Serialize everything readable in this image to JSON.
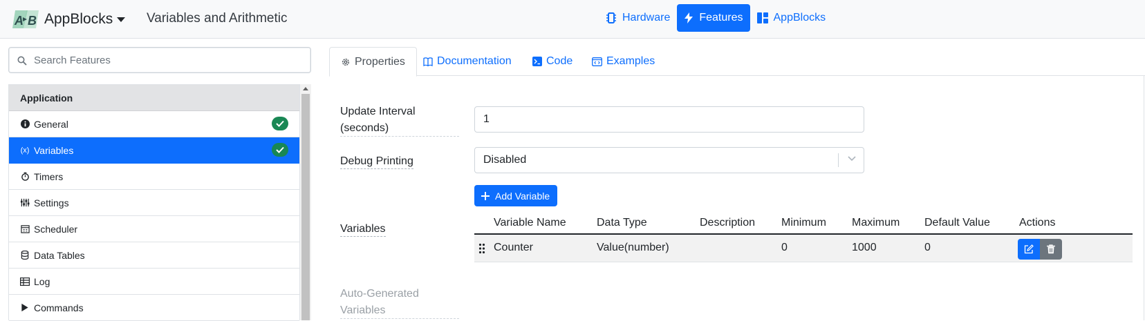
{
  "app": {
    "brand": "AppBlocks",
    "page_title": "Variables and Arithmetic",
    "accent_color": "#0d6efd",
    "success_color": "#198754"
  },
  "topnav": {
    "hardware": "Hardware",
    "features": "Features",
    "appblocks": "AppBlocks"
  },
  "sidebar": {
    "search_placeholder": "Search Features",
    "group": "Application",
    "items": [
      {
        "label": "General",
        "icon": "info-circle-icon",
        "checked": true
      },
      {
        "label": "Variables",
        "icon": "variable-icon",
        "checked": true,
        "active": true
      },
      {
        "label": "Timers",
        "icon": "stopwatch-icon"
      },
      {
        "label": "Settings",
        "icon": "sliders-icon"
      },
      {
        "label": "Scheduler",
        "icon": "calendar-icon"
      },
      {
        "label": "Data Tables",
        "icon": "database-icon"
      },
      {
        "label": "Log",
        "icon": "log-table-icon"
      },
      {
        "label": "Commands",
        "icon": "play-icon"
      }
    ]
  },
  "tabs": {
    "properties": "Properties",
    "documentation": "Documentation",
    "code": "Code",
    "examples": "Examples"
  },
  "form": {
    "update_interval_label_1": "Update Interval",
    "update_interval_label_2": "(seconds)",
    "update_interval_value": "1",
    "debug_label": "Debug Printing",
    "debug_value": "Disabled",
    "add_variable": "Add Variable",
    "variables_label": "Variables",
    "auto_label_1": "Auto-Generated",
    "auto_label_2": "Variables"
  },
  "variables_table": {
    "headers": [
      "Variable Name",
      "Data Type",
      "Description",
      "Minimum",
      "Maximum",
      "Default Value",
      "Actions"
    ],
    "rows": [
      [
        "Counter",
        "Value(number)",
        "",
        "0",
        "1000",
        "0"
      ]
    ]
  }
}
